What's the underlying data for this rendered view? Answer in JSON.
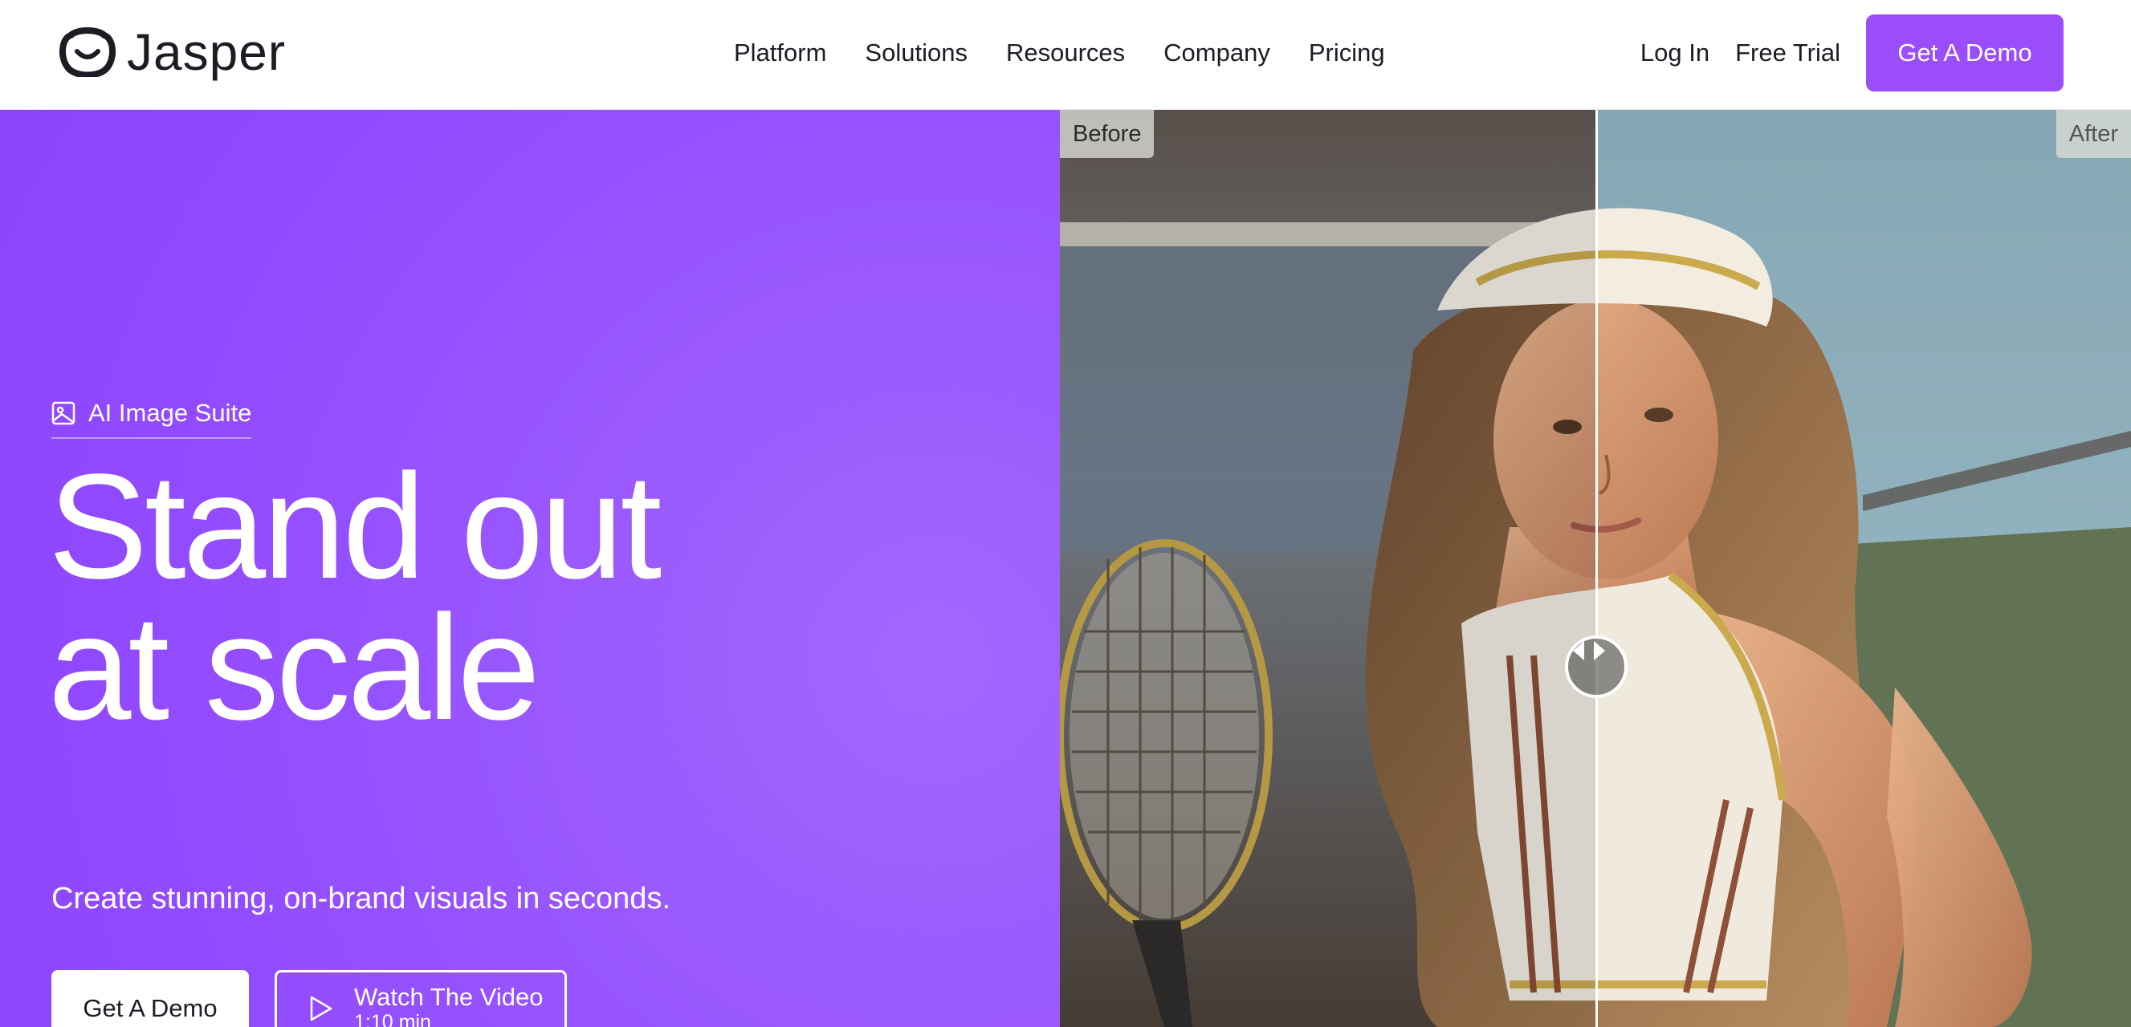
{
  "brand": {
    "name": "Jasper",
    "accent": "#9a4df8"
  },
  "nav": {
    "links": [
      "Platform",
      "Solutions",
      "Resources",
      "Company",
      "Pricing"
    ],
    "login": "Log In",
    "free_trial": "Free Trial",
    "cta": "Get A Demo"
  },
  "hero": {
    "eyebrow": "AI Image Suite",
    "eyebrow_icon": "image-icon",
    "headline_line1": "Stand out",
    "headline_line2": "at scale",
    "subhead": "Create stunning, on-brand visuals in seconds.",
    "primary_cta": "Get A Demo",
    "video_cta": "Watch The Video",
    "video_duration": "1:10 min",
    "background": "#9b5afd"
  },
  "compare": {
    "before_label": "Before",
    "after_label": "After",
    "split_fraction": 0.5
  }
}
